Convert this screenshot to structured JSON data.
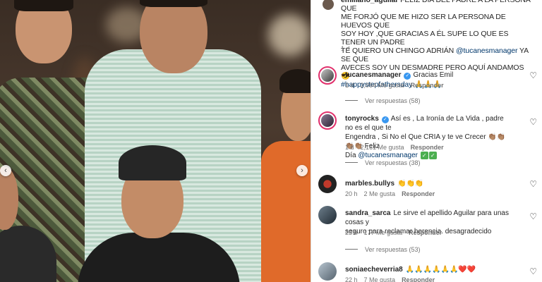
{
  "post": {
    "caption": {
      "username": "emiliano_aguilar",
      "line1": "FELIZ DÍA DEL PADRE A LA PERSONA QUE",
      "line2": "ME FORJÓ QUE ME HIZO SER LA PERSONA DE HUEVOS QUE",
      "line3": "SOY HOY ,QUE GRACIAS A ÉL SUPE LO QUE ES TENER UN PADRE",
      "line4a": "TE QUIERO UN CHINGO ADRIÁN",
      "mention": "@tucanesmanager",
      "line4b": "YA SE QUE",
      "line5": "AVECES SOY UN DESMADRE PERO AQUÍ ANDAMOS 😎",
      "hashtag": "#happystepfathersday",
      "hashtag_suffix": "🙏🙏🙏",
      "time": "1 d"
    },
    "comments": [
      {
        "username": "tucanesmanager",
        "verified": true,
        "text": "Gracias Emil",
        "time": "1 d",
        "likes": "2,094 Me gusta",
        "reply": "Responder",
        "view_replies": "Ver respuestas (58)"
      },
      {
        "username": "tonyrocks",
        "verified": true,
        "text_line1": "Así es , La Ironía de La Vida , padre no es el que te",
        "text_line2": "Engendra , Si No el Que CRIA y te ve Crecer 👏🏽👏🏽👏🏽👏🏽 Feliz",
        "text_line3a": "Día",
        "mention": "@tucanesmanager",
        "check1": "✓",
        "check2": "✓",
        "time": "1 d",
        "likes": "2,161 Me gusta",
        "reply": "Responder",
        "view_replies": "Ver respuestas (38)"
      },
      {
        "username": "marbles.bullys",
        "text": "👏👏👏",
        "time": "20 h",
        "likes": "2 Me gusta",
        "reply": "Responder"
      },
      {
        "username": "sandra_sarca",
        "text_line1": "Le sirve el apellido Aguilar para unas cosas y",
        "text_line2": "seguro para reclamar herencia. desagradecido",
        "time": "23 h",
        "likes": "177 Me gusta",
        "reply": "Responder",
        "view_replies": "Ver respuestas (53)"
      },
      {
        "username": "soniaecheverria8",
        "text": "🙏🙏🙏🙏🙏🙏❤️❤️",
        "time": "22 h",
        "likes": "7 Me gusta",
        "reply": "Responder"
      }
    ]
  },
  "icons": {
    "heart": "♡",
    "prev": "‹",
    "next": "›",
    "verified": "✓"
  },
  "colors": {
    "link": "#00376b",
    "verified": "#3897f0",
    "story_ring": "#e1306c",
    "muted": "#737373"
  }
}
